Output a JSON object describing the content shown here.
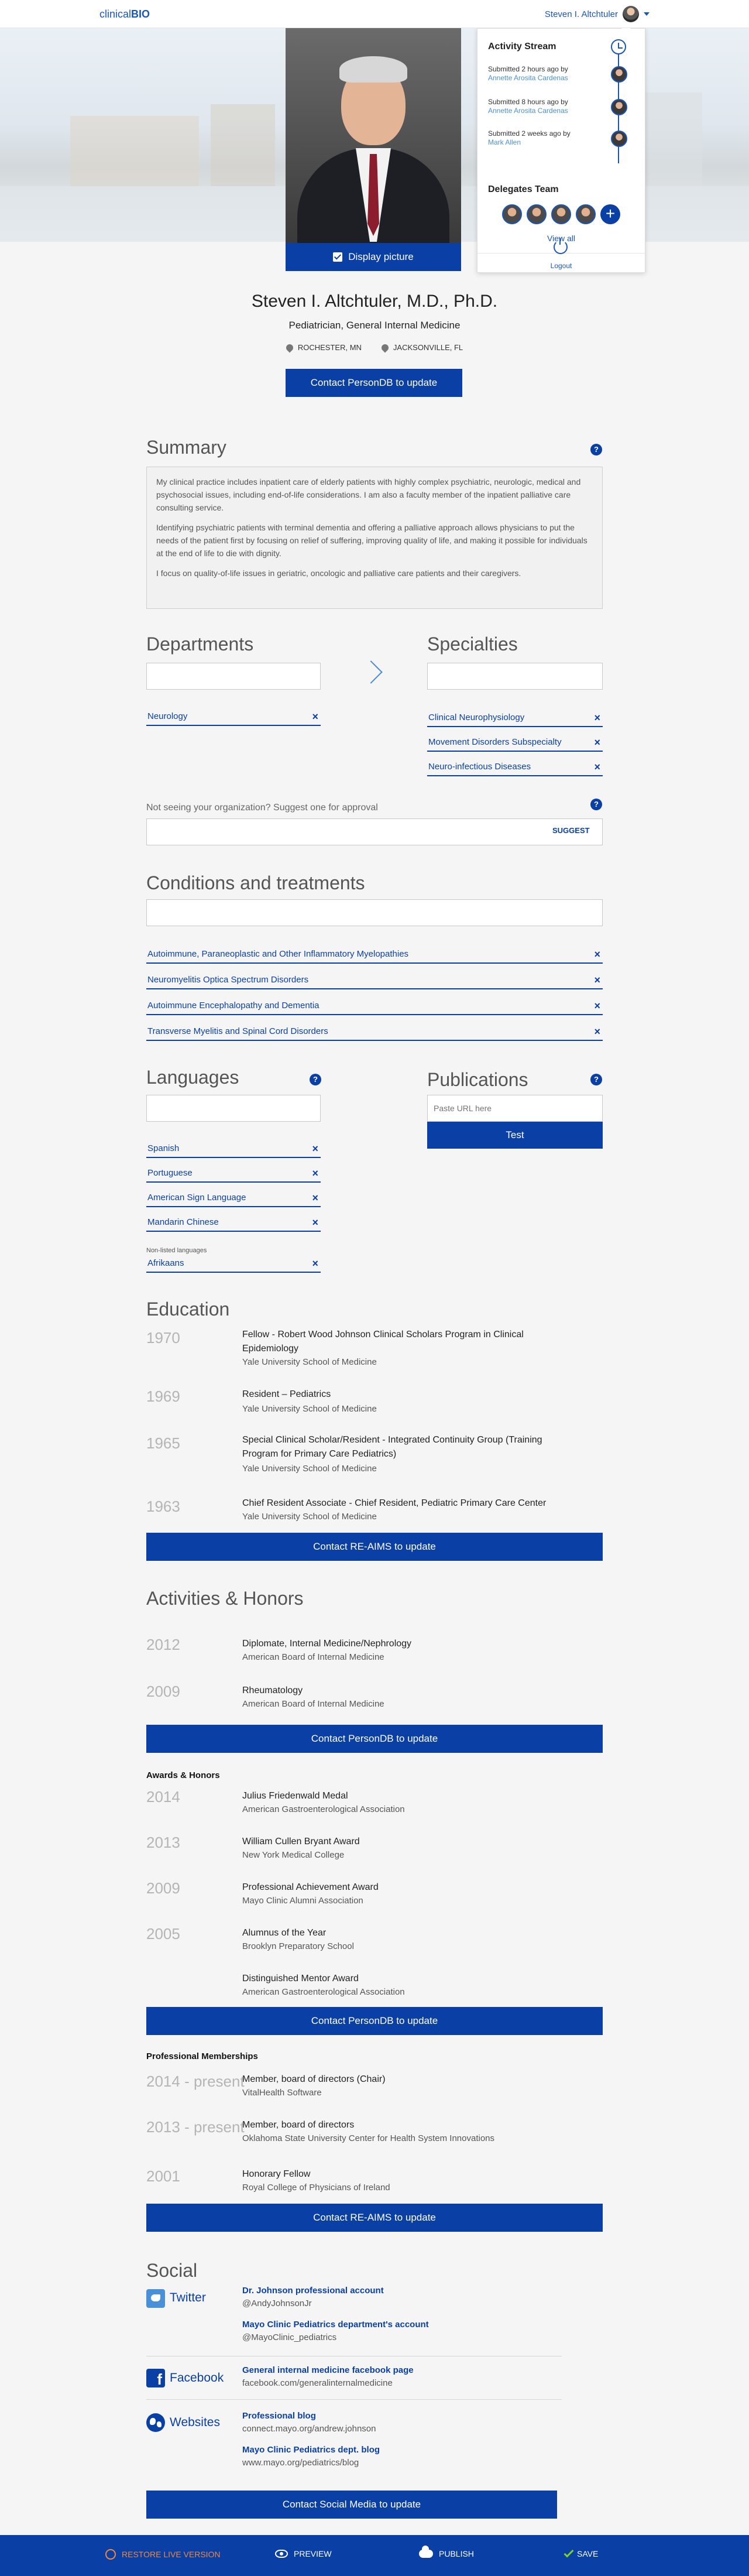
{
  "nav": {
    "logo_light": "clinical",
    "logo_bold": "BIO",
    "user_name": "Steven I. Altchtuler"
  },
  "photo": {
    "display_label": "Display picture"
  },
  "activity": {
    "title": "Activity Stream",
    "items": [
      {
        "time": "Submitted 2 hours ago by",
        "who": "Annette Arosita Cardenas"
      },
      {
        "time": "Submitted 8 hours ago by",
        "who": "Annette Arosita Cardenas"
      },
      {
        "time": "Submitted 2 weeks ago by",
        "who": "Mark Allen"
      }
    ],
    "delegates_title": "Delegates Team",
    "view_all": "View all",
    "logout": "Logout"
  },
  "profile": {
    "name": "Steven I. Altchtuler, M.D., Ph.D.",
    "title": "Pediatrician, General Internal Medicine",
    "locations": [
      "ROCHESTER, MN",
      "JACKSONVILLE, FL"
    ],
    "contact_button": "Contact PersonDB to update"
  },
  "summary": {
    "heading": "Summary",
    "paragraphs": [
      "My clinical practice includes inpatient care of elderly patients with highly complex psychiatric, neurologic, medical and psychosocial issues, including end-of-life considerations. I am also a faculty member of the inpatient palliative care consulting service.",
      "Identifying psychiatric patients with terminal dementia and offering a palliative approach allows physicians to put the needs of the patient first by focusing on relief of suffering, improving quality of life, and making it possible for individuals at the end of life to die with dignity.",
      "I focus on quality-of-life issues in geriatric, oncologic and palliative care patients and their caregivers."
    ]
  },
  "departments": {
    "heading": "Departments",
    "items": [
      "Neurology"
    ]
  },
  "specialties": {
    "heading": "Specialties",
    "items": [
      "Clinical Neurophysiology",
      "Movement Disorders Subspecialty",
      "Neuro-infectious Diseases"
    ]
  },
  "suggest": {
    "label": "Not seeing your organization? Suggest one for approval",
    "button": "SUGGEST"
  },
  "conditions": {
    "heading": "Conditions and treatments",
    "items": [
      "Autoimmune, Paraneoplastic and Other Inflammatory Myelopathies",
      "Neuromyelitis Optica Spectrum Disorders",
      "Autoimmune Encephalopathy and Dementia",
      "Transverse Myelitis and Spinal Cord Disorders"
    ]
  },
  "languages": {
    "heading": "Languages",
    "items": [
      "Spanish",
      "Portuguese",
      "American Sign Language",
      "Mandarin Chinese"
    ],
    "non_listed_label": "Non-listed languages",
    "non_listed": [
      "Afrikaans"
    ]
  },
  "publications": {
    "heading": "Publications",
    "placeholder": "Paste URL here",
    "button": "Test"
  },
  "education": {
    "heading": "Education",
    "items": [
      {
        "year": "1970",
        "title": "Fellow - Robert Wood Johnson Clinical Scholars Program in Clinical Epidemiology",
        "org": "Yale University School of Medicine"
      },
      {
        "year": "1969",
        "title": "Resident – Pediatrics",
        "org": "Yale University School of Medicine"
      },
      {
        "year": "1965",
        "title": "Special Clinical Scholar/Resident - Integrated Continuity Group (Training Program for Primary Care Pediatrics)",
        "org": "Yale University School of Medicine"
      },
      {
        "year": "1963",
        "title": "Chief Resident Associate - Chief Resident, Pediatric Primary Care Center",
        "org": "Yale University School of Medicine"
      }
    ],
    "button": "Contact RE-AIMS to update"
  },
  "activities": {
    "heading": "Activities & Honors",
    "items": [
      {
        "year": "2012",
        "title": "Diplomate, Internal Medicine/Nephrology",
        "org": "American Board of Internal Medicine"
      },
      {
        "year": "2009",
        "title": "Rheumatology",
        "org": "American Board of Internal Medicine"
      }
    ],
    "button": "Contact PersonDB to update",
    "awards_heading": "Awards & Honors",
    "awards": [
      {
        "year": "2014",
        "title": "Julius Friedenwald Medal",
        "org": "American Gastroenterological Association"
      },
      {
        "year": "2013",
        "title": "William Cullen Bryant Award",
        "org": "New York Medical College"
      },
      {
        "year": "2009",
        "title": "Professional Achievement Award",
        "org": "Mayo Clinic Alumni Association"
      },
      {
        "year": "2005",
        "title": "Alumnus of the Year",
        "org": "Brooklyn Preparatory School"
      },
      {
        "year": "",
        "title": "Distinguished Mentor Award",
        "org": "American Gastroenterological Association"
      }
    ],
    "awards_button": "Contact PersonDB to update",
    "memberships_heading": "Professional Memberships",
    "memberships": [
      {
        "year": "2014 - present",
        "title": "Member, board of directors (Chair)",
        "org": "VitalHealth Software"
      },
      {
        "year": "2013 - present",
        "title": "Member, board of directors",
        "org": "Oklahoma State University Center for Health System Innovations"
      },
      {
        "year": "2001",
        "title": "Honorary Fellow",
        "org": "Royal College of Physicians of Ireland"
      }
    ],
    "memberships_button": "Contact RE-AIMS to update"
  },
  "social": {
    "heading": "Social",
    "twitter_label": "Twitter",
    "twitter": [
      {
        "name": "Dr. Johnson professional account",
        "handle": "@AndyJohnsonJr"
      },
      {
        "name": "Mayo Clinic Pediatrics department's account",
        "handle": "@MayoClinic_pediatrics"
      }
    ],
    "facebook_label": "Facebook",
    "facebook": [
      {
        "name": "General internal medicine facebook page",
        "handle": "facebook.com/generalinternalmedicine"
      }
    ],
    "websites_label": "Websites",
    "websites": [
      {
        "name": "Professional blog",
        "handle": "connect.mayo.org/andrew.johnson"
      },
      {
        "name": "Mayo Clinic Pediatrics dept. blog",
        "handle": "www.mayo.org/pediatrics/blog"
      }
    ],
    "button": "Contact Social Media to update"
  },
  "bottom": {
    "restore": "RESTORE LIVE VERSION",
    "preview": "PREVIEW",
    "publish": "PUBLISH",
    "save": "SAVE"
  },
  "colors": {
    "primary": "#0a3fa5",
    "link": "#1a56b8",
    "restore": "#f08a3c",
    "save": "#7ed321"
  }
}
